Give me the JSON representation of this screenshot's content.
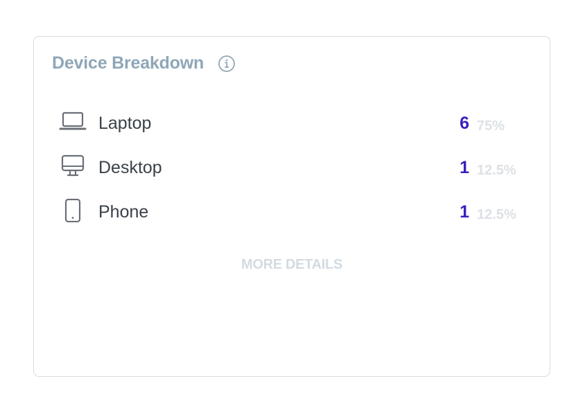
{
  "card": {
    "title": "Device Breakdown",
    "more_details_label": "MORE DETAILS"
  },
  "devices": [
    {
      "icon": "laptop-icon",
      "label": "Laptop",
      "count": "6",
      "percent": "75%"
    },
    {
      "icon": "desktop-icon",
      "label": "Desktop",
      "count": "1",
      "percent": "12.5%"
    },
    {
      "icon": "phone-icon",
      "label": "Phone",
      "count": "1",
      "percent": "12.5%"
    }
  ],
  "colors": {
    "title": "#8fa6b7",
    "count": "#3b1fbf",
    "percent": "#dde1e5",
    "icon": "#6b7077",
    "more_details": "#d3dbe1",
    "border": "#d6dde3"
  }
}
